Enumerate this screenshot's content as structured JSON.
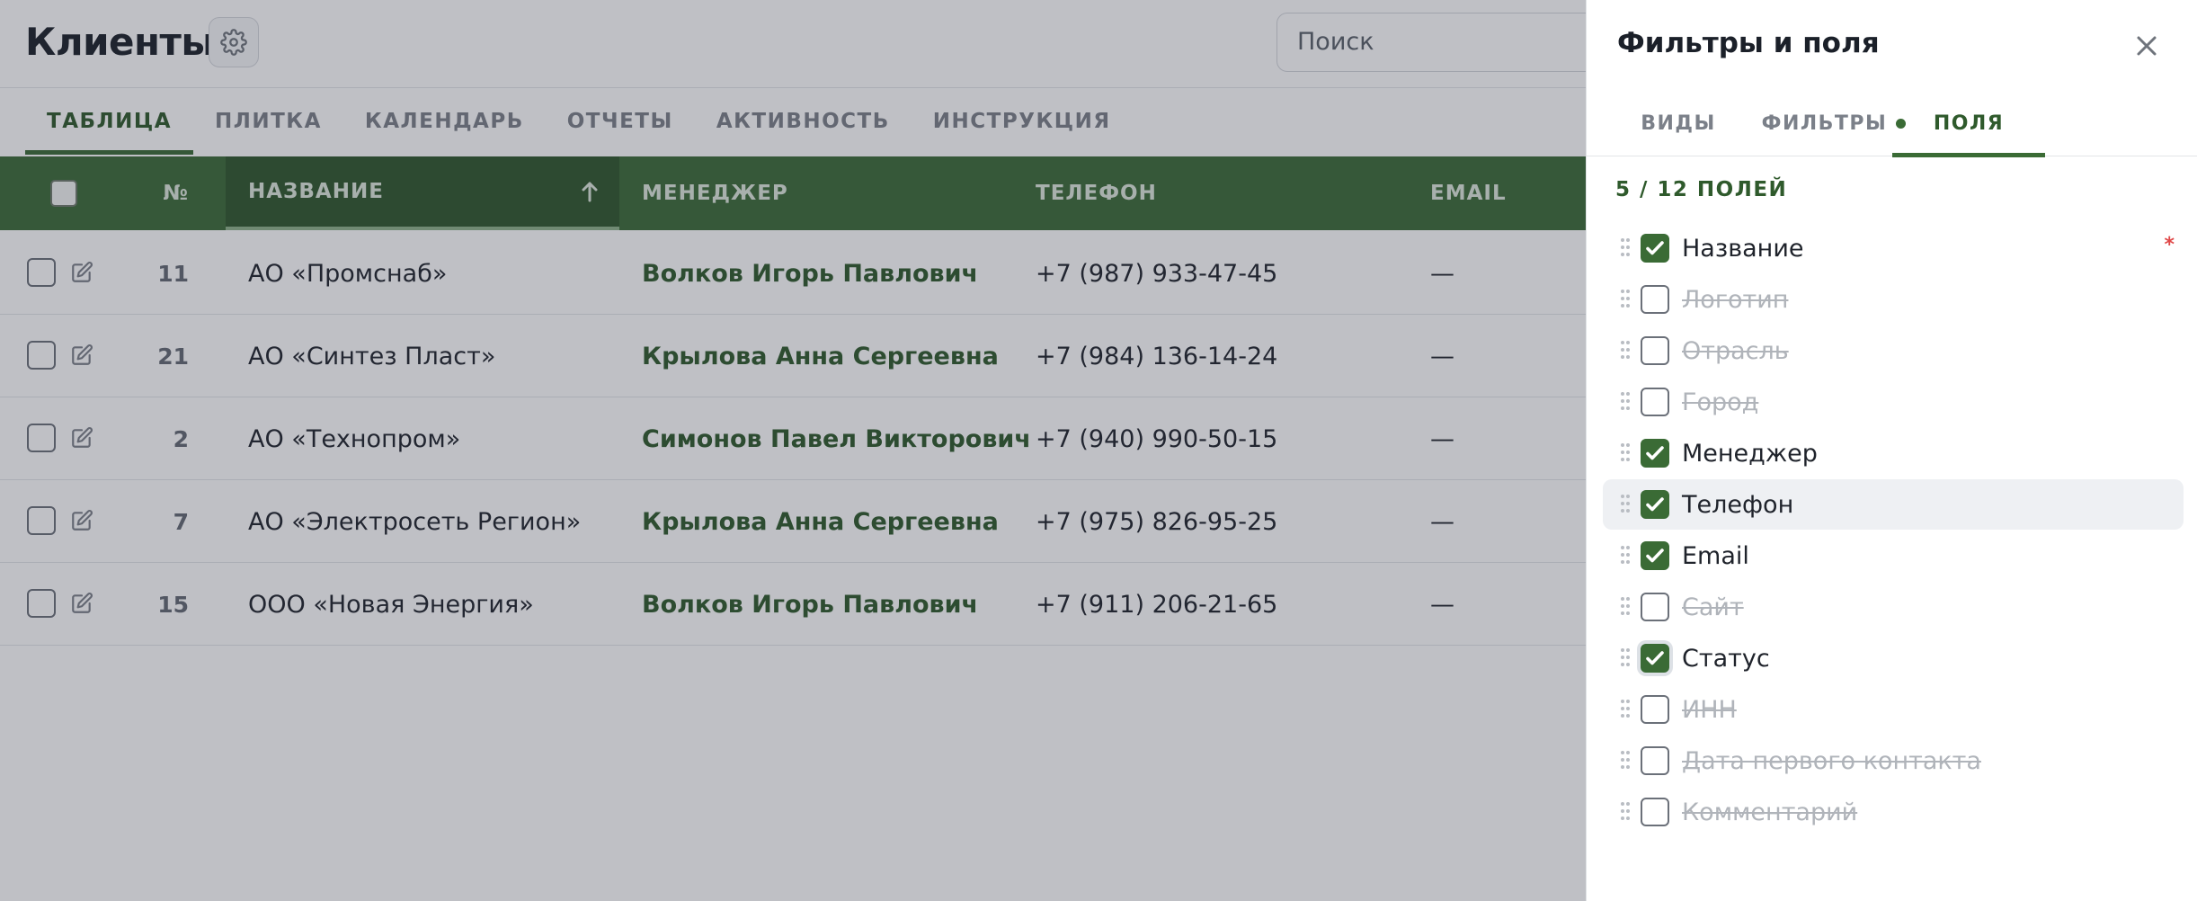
{
  "header": {
    "title": "Клиенты",
    "search_placeholder": "Поиск"
  },
  "tabs": [
    {
      "label": "ТАБЛИЦА",
      "active": true
    },
    {
      "label": "ПЛИТКА",
      "active": false
    },
    {
      "label": "КАЛЕНДАРЬ",
      "active": false
    },
    {
      "label": "ОТЧЕТЫ",
      "active": false
    },
    {
      "label": "АКТИВНОСТЬ",
      "active": false
    },
    {
      "label": "ИНСТРУКЦИЯ",
      "active": false
    }
  ],
  "table": {
    "columns": {
      "num": "№",
      "name": "НАЗВАНИЕ",
      "manager": "МЕНЕДЖЕР",
      "phone": "ТЕЛЕФОН",
      "email": "EMAIL"
    },
    "sorted_column": "name",
    "rows": [
      {
        "num": "11",
        "name": "АО «Промснаб»",
        "manager": "Волков Игорь Павлович",
        "phone": "+7 (987) 933-47-45",
        "email": "—"
      },
      {
        "num": "21",
        "name": "АО «Синтез Пласт»",
        "manager": "Крылова Анна Сергеевна",
        "phone": "+7 (984) 136-14-24",
        "email": "—"
      },
      {
        "num": "2",
        "name": "АО «Технопром»",
        "manager": "Симонов Павел Викторович",
        "phone": "+7 (940) 990-50-15",
        "email": "—"
      },
      {
        "num": "7",
        "name": "АО «Электросеть Регион»",
        "manager": "Крылова Анна Сергеевна",
        "phone": "+7 (975) 826-95-25",
        "email": "—"
      },
      {
        "num": "15",
        "name": "ООО «Новая Энергия»",
        "manager": "Волков Игорь Павлович",
        "phone": "+7 (911) 206-21-65",
        "email": "—"
      }
    ]
  },
  "panel": {
    "title": "Фильтры и поля",
    "tabs": [
      {
        "label": "ВИДЫ",
        "active": false
      },
      {
        "label": "ФИЛЬТРЫ",
        "active": false,
        "indicator": true
      },
      {
        "label": "ПОЛЯ",
        "active": true
      }
    ],
    "count_label": "5 / 12 ПОЛЕЙ",
    "required_mark": "*",
    "fields": [
      {
        "label": "Название",
        "checked": true
      },
      {
        "label": "Логотип",
        "checked": false
      },
      {
        "label": "Отрасль",
        "checked": false
      },
      {
        "label": "Город",
        "checked": false
      },
      {
        "label": "Менеджер",
        "checked": true
      },
      {
        "label": "Телефон",
        "checked": true
      },
      {
        "label": "Email",
        "checked": true
      },
      {
        "label": "Сайт",
        "checked": false
      },
      {
        "label": "Статус",
        "checked": true
      },
      {
        "label": "ИНН",
        "checked": false
      },
      {
        "label": "Дата первого контакта",
        "checked": false
      },
      {
        "label": "Комментарий",
        "checked": false
      }
    ]
  },
  "colors": {
    "accent": "#3b6a37",
    "accent_dark": "#2f572c",
    "required": "#e04848"
  }
}
